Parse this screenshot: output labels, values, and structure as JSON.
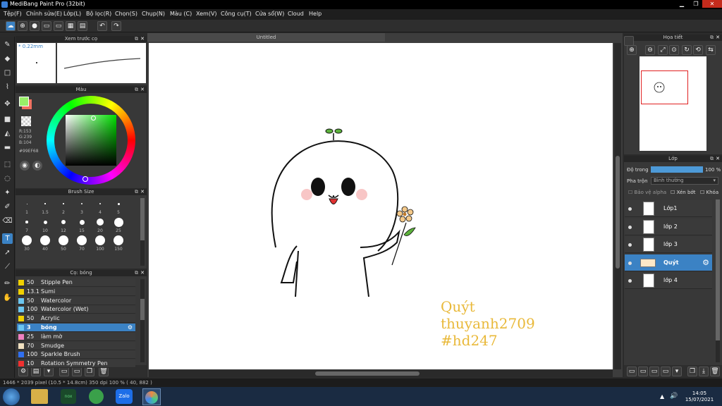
{
  "window": {
    "title": "MediBang Paint Pro (32bit)"
  },
  "menu": [
    "Tệp(F)",
    "Chỉnh sửa(E)",
    "Lớp(L)",
    "Bộ lọc(R)",
    "Chọn(S)",
    "Chụp(N)",
    "Màu (C)",
    "Xem(V)",
    "Công cụ(T)",
    "Cửa sổ(W)",
    "Cloud",
    "Help"
  ],
  "panels": {
    "preview": "Xem trước cọ",
    "color": "Màu",
    "brushsize": "Brush Size",
    "brush": "Cọ: bóng",
    "navigator": "Họa tiết",
    "layer": "Lớp"
  },
  "brush_preview_size": "* 0.22mm",
  "color": {
    "r": "R:153",
    "g": "G:239",
    "b": "B:104",
    "hex": "#99EF68",
    "fg": "#99EF68",
    "bg": "#f07060"
  },
  "brush_sizes": [
    "1",
    "1.5",
    "2",
    "3",
    "4",
    "5",
    "7",
    "10",
    "12",
    "15",
    "20",
    "25",
    "30",
    "40",
    "50",
    "70",
    "100",
    "150"
  ],
  "brushes": [
    {
      "size": "50",
      "name": "Stipple Pen",
      "color": "#f0d000"
    },
    {
      "size": "13.1",
      "name": "Sumi",
      "color": "#f0d000"
    },
    {
      "size": "50",
      "name": "Watercolor",
      "color": "#6cc6f0"
    },
    {
      "size": "100",
      "name": "Watercolor (Wet)",
      "color": "#6cc6f0"
    },
    {
      "size": "50",
      "name": "Acrylic",
      "color": "#f0d000"
    },
    {
      "size": "3",
      "name": "bóng",
      "color": "#6cc6f0"
    },
    {
      "size": "25",
      "name": "làm mờ",
      "color": "#f080c0"
    },
    {
      "size": "70",
      "name": "Smudge",
      "color": "#f0e0c0"
    },
    {
      "size": "100",
      "name": "Sparkle Brush",
      "color": "#3070f0"
    },
    {
      "size": "10",
      "name": "Rotation Symmetry Pen",
      "color": "#f03030"
    }
  ],
  "doc_tab": "Untitled",
  "canvas_text": [
    "Quýt",
    "thuyanh2709",
    "#hd247"
  ],
  "layer": {
    "opacity_label": "Độ trong",
    "opacity_value": "100 %",
    "blend_label": "Pha trộn",
    "blend_value": "Bình thường",
    "protect_alpha": "Bảo vệ alpha",
    "clipping": "Xén bớt",
    "lock": "Khóa",
    "layers": [
      "Lớp1",
      "lớp 2",
      "lớp 3",
      "Quýt",
      "lớp 4"
    ]
  },
  "status": {
    "text": "1446 * 2039 pixel  (10.5 * 14.8cm)  350 dpi  100 %  ( 40, 882 )"
  },
  "clock": {
    "time": "14:05",
    "date": "15/07/2021"
  }
}
